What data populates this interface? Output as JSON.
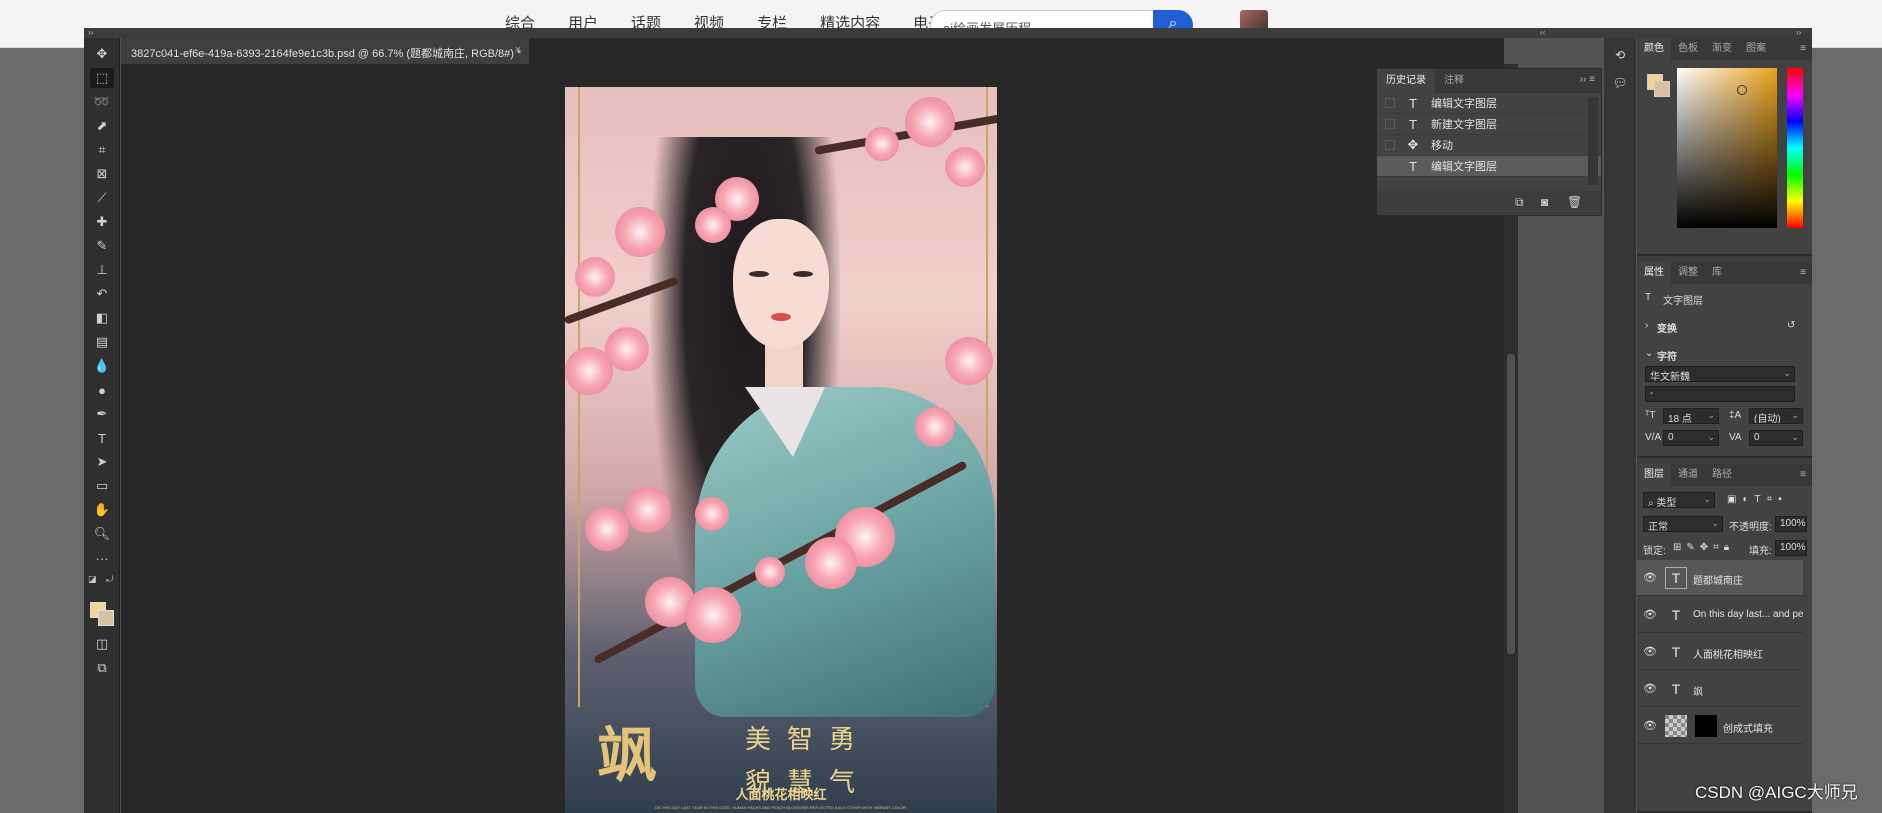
{
  "website": {
    "nav": [
      "综合",
      "用户",
      "话题",
      "视频",
      "专栏",
      "精选内容",
      "电子书"
    ],
    "search_value": "ai绘画发展历程",
    "search_icon": "search-icon"
  },
  "document": {
    "tab_title": "3827c041-ef6e-419a-6393-2164fe9e1c3b.psd @ 66.7% (题都城南庄, RGB/8#) *",
    "tab_close": "×"
  },
  "artwork": {
    "big_char": "飒",
    "col_chars": [
      "美",
      "智",
      "勇",
      "貌",
      "慧",
      "气"
    ],
    "subtitle": "人面桃花相映红",
    "tiny_text": "ON THIS DAY LAST YEAR IN THIS GATE, HUMAN FACES AND PEACH BLOSSOMS REFLECTED EACH OTHER WITH VIBRANT COLOR."
  },
  "history": {
    "tabs": [
      "历史记录",
      "注释"
    ],
    "items": [
      {
        "icon": "T",
        "label": "编辑文字图层"
      },
      {
        "icon": "T",
        "label": "新建文字图层"
      },
      {
        "icon": "✥",
        "label": "移动"
      },
      {
        "icon": "T",
        "label": "编辑文字图层"
      }
    ],
    "selected_index": 3
  },
  "color_panel": {
    "tabs": [
      "颜色",
      "色板",
      "渐变",
      "图案"
    ],
    "foreground": "#f2d49a",
    "background": "#d8bfa0"
  },
  "properties": {
    "tabs": [
      "属性",
      "调整",
      "库"
    ],
    "layer_kind": "文字图层",
    "transform_label": "变换",
    "character_label": "字符",
    "font_family": "华文新魏",
    "font_style": "-",
    "font_size": "18 点",
    "leading": "(自动)",
    "kerning": "0",
    "tracking": "0"
  },
  "layers": {
    "tabs": [
      "图层",
      "通道",
      "路径"
    ],
    "filter_kind": "类型",
    "blend_mode": "正常",
    "opacity_label": "不透明度:",
    "opacity_value": "100%",
    "lock_label": "锁定:",
    "fill_label": "填充:",
    "fill_value": "100%",
    "items": [
      {
        "name": "题都城南庄",
        "icon": "T"
      },
      {
        "name": "On this day last... and peach bloss",
        "icon": "T"
      },
      {
        "name": "人面桃花相映红",
        "icon": "T"
      },
      {
        "name": "飒",
        "icon": "T"
      },
      {
        "name": "创成式填充",
        "icon": "mask"
      }
    ],
    "selected_index": 0
  },
  "watermark": "CSDN @AIGC大师兄"
}
